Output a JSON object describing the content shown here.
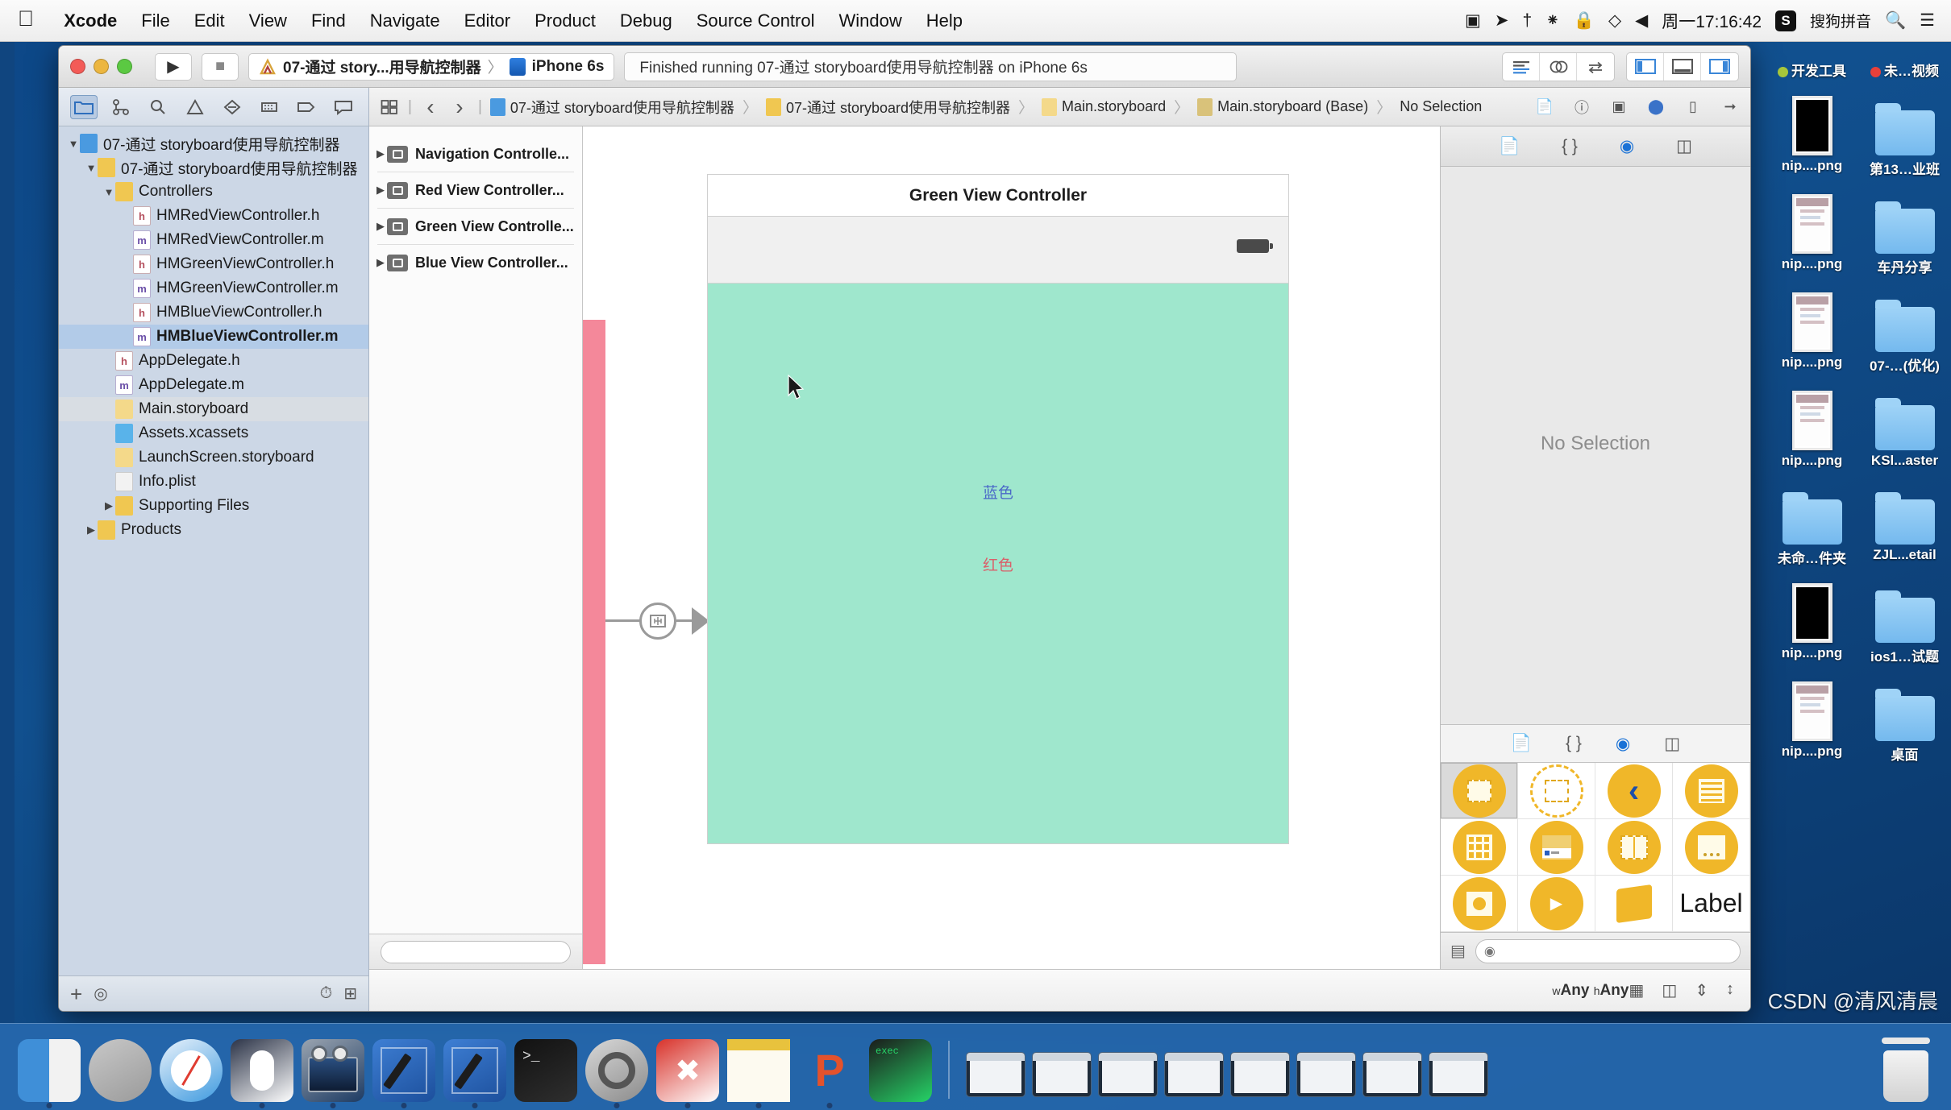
{
  "menubar": {
    "apple_icon": "apple-logo",
    "items": [
      {
        "label": "Xcode",
        "bold": true
      },
      {
        "label": "File",
        "bold": false
      },
      {
        "label": "Edit",
        "bold": false
      },
      {
        "label": "View",
        "bold": false
      },
      {
        "label": "Find",
        "bold": false
      },
      {
        "label": "Navigate",
        "bold": false
      },
      {
        "label": "Editor",
        "bold": false
      },
      {
        "label": "Product",
        "bold": false
      },
      {
        "label": "Debug",
        "bold": false
      },
      {
        "label": "Source Control",
        "bold": false
      },
      {
        "label": "Window",
        "bold": false
      },
      {
        "label": "Help",
        "bold": false
      }
    ],
    "status_icons": [
      "screen-record-icon",
      "location-icon",
      "bluetooth-icon",
      "airdrop-icon",
      "lock-icon",
      "shield-icon",
      "volume-icon"
    ],
    "clock": "周一17:16:42",
    "ime_badge": "S",
    "ime_label": "搜狗拼音",
    "search_icon": "search-icon",
    "control_center_icon": "list-icon"
  },
  "xcode": {
    "toolbar": {
      "run_label": "run-button",
      "stop_label": "stop-button",
      "scheme_name": "07-通过 story...用导航控制器",
      "scheme_separator": "〉",
      "destination": "iPhone 6s",
      "activity": "Finished running 07-通过 storyboard使用导航控制器 on iPhone 6s",
      "right_groups": [
        [
          "standard-editor-icon",
          "assistant-editor-icon",
          "version-editor-icon"
        ],
        [
          "toggle-navigator-icon",
          "toggle-debug-area-icon",
          "toggle-utilities-icon"
        ]
      ]
    },
    "navigator": {
      "tabs": [
        "folder-icon",
        "source-control-icon",
        "search-icon",
        "warning-icon",
        "test-icon",
        "debug-icon",
        "breakpoint-icon",
        "report-icon"
      ],
      "selected_tab_index": 0,
      "tree": [
        {
          "label": "07-通过 storyboard使用导航控制器",
          "depth": 0,
          "icon": "project",
          "twisty": "▼",
          "state": "normal"
        },
        {
          "label": "07-通过 storyboard使用导航控制器",
          "depth": 1,
          "icon": "folder",
          "twisty": "▼",
          "state": "normal"
        },
        {
          "label": "Controllers",
          "depth": 2,
          "icon": "folder",
          "twisty": "▼",
          "state": "normal"
        },
        {
          "label": "HMRedViewController.h",
          "depth": 3,
          "icon": "h",
          "twisty": "",
          "state": "normal"
        },
        {
          "label": "HMRedViewController.m",
          "depth": 3,
          "icon": "m",
          "twisty": "",
          "state": "normal"
        },
        {
          "label": "HMGreenViewController.h",
          "depth": 3,
          "icon": "h",
          "twisty": "",
          "state": "normal"
        },
        {
          "label": "HMGreenViewController.m",
          "depth": 3,
          "icon": "m",
          "twisty": "",
          "state": "normal"
        },
        {
          "label": "HMBlueViewController.h",
          "depth": 3,
          "icon": "h",
          "twisty": "",
          "state": "normal"
        },
        {
          "label": "HMBlueViewController.m",
          "depth": 3,
          "icon": "m",
          "twisty": "",
          "state": "selected"
        },
        {
          "label": "AppDelegate.h",
          "depth": 2,
          "icon": "h",
          "twisty": "",
          "state": "normal"
        },
        {
          "label": "AppDelegate.m",
          "depth": 2,
          "icon": "m",
          "twisty": "",
          "state": "normal"
        },
        {
          "label": "Main.storyboard",
          "depth": 2,
          "icon": "sb",
          "twisty": "",
          "state": "highlight"
        },
        {
          "label": "Assets.xcassets",
          "depth": 2,
          "icon": "xc",
          "twisty": "",
          "state": "normal"
        },
        {
          "label": "LaunchScreen.storyboard",
          "depth": 2,
          "icon": "sb",
          "twisty": "",
          "state": "normal"
        },
        {
          "label": "Info.plist",
          "depth": 2,
          "icon": "pl",
          "twisty": "",
          "state": "normal"
        },
        {
          "label": "Supporting Files",
          "depth": 2,
          "icon": "folder",
          "twisty": "▶",
          "state": "normal"
        },
        {
          "label": "Products",
          "depth": 1,
          "icon": "folder",
          "twisty": "▶",
          "state": "normal"
        }
      ],
      "footer": {
        "add_icon": "+",
        "filter_icon": "filter-icon",
        "recent_icon": "clock-icon",
        "unsaved_icon": "unsaved-icon"
      }
    },
    "jumpbar": {
      "related_icon": "related-items-icon",
      "back_icon": "‹",
      "forward_icon": "›",
      "breadcrumbs": [
        "07-通过 storyboard使用导航控制器",
        "07-通过 storyboard使用导航控制器",
        "Main.storyboard",
        "Main.storyboard (Base)",
        "No Selection"
      ],
      "right_icons": [
        "page-icon",
        "help-icon",
        "minimap-icon",
        "shield-icon",
        "device-icon",
        "arrow-icon"
      ]
    },
    "outline": {
      "items": [
        {
          "label": "Navigation Controlle...",
          "twisty": "▶"
        },
        {
          "label": "Red View Controller...",
          "twisty": "▶"
        },
        {
          "label": "Green View Controlle...",
          "twisty": "▶"
        },
        {
          "label": "Blue View Controller...",
          "twisty": "▶"
        }
      ],
      "footer_icon": "filter-oval"
    },
    "canvas": {
      "scene_title": "Green View Controller",
      "labels": [
        {
          "text": "蓝色",
          "color": "#4a68c8"
        },
        {
          "text": "红色",
          "color": "#d9606a"
        }
      ],
      "segue_icon": "segue-icon",
      "cursor_icon": "mouse-cursor",
      "bottom_bar": {
        "size_class_w": "wAny",
        "size_class_h": "hAny",
        "w_prefix": "w",
        "h_prefix": "h",
        "right_icons": [
          "grid-icon",
          "constraints-icon",
          "align-icon",
          "resolve-icon"
        ]
      }
    },
    "inspector": {
      "tabs": [
        "file-inspector-icon",
        "quick-help-icon",
        "identity-inspector-icon",
        "attributes-inspector-icon"
      ],
      "selected_tab_index": 2,
      "empty_label": "No Selection",
      "library_tabs": [
        "file-template-library-icon",
        "code-snippet-library-icon",
        "object-library-icon",
        "media-library-icon"
      ],
      "library_selected_index": 2,
      "library_items": [
        {
          "name": "view-controller-object",
          "glyph": "sq",
          "selected": true
        },
        {
          "name": "storyboard-reference-object",
          "glyph": "ghost",
          "selected": false
        },
        {
          "name": "navigation-controller-object",
          "glyph": "chev",
          "selected": false
        },
        {
          "name": "table-view-controller-object",
          "glyph": "list",
          "selected": false
        },
        {
          "name": "collection-view-controller-object",
          "glyph": "grid",
          "selected": false
        },
        {
          "name": "tab-bar-controller-object",
          "glyph": "tabbar",
          "selected": false
        },
        {
          "name": "split-view-controller-object",
          "glyph": "split",
          "selected": false
        },
        {
          "name": "page-view-controller-object",
          "glyph": "page",
          "selected": false
        }
      ],
      "library_row3": [
        {
          "name": "glkit-view-controller-object",
          "glyph": "circle"
        },
        {
          "name": "avkit-player-view-controller-object",
          "glyph": "player"
        },
        {
          "name": "object-cube",
          "glyph": "cube"
        },
        {
          "name": "label-object",
          "glyph": "label",
          "text": "Label"
        }
      ],
      "library_search_icon": "search-oval",
      "library_grid_icon": "grid-view-icon"
    }
  },
  "desktop": {
    "tags": [
      {
        "label": "开发工具",
        "color": "#a8c83c"
      },
      {
        "label": "未…视频",
        "color": "#e8403a"
      }
    ],
    "icons": [
      {
        "label": "nip....png",
        "type": "shot-black"
      },
      {
        "label": "第13…业班",
        "type": "folder"
      },
      {
        "label": "nip....png",
        "type": "shot-ui"
      },
      {
        "label": "车丹分享",
        "type": "folder"
      },
      {
        "label": "nip....png",
        "type": "shot-ui"
      },
      {
        "label": "07-…(优化)",
        "type": "folder"
      },
      {
        "label": "nip....png",
        "type": "shot-ui"
      },
      {
        "label": "KSl...aster",
        "type": "folder"
      },
      {
        "label": "未命…件夹",
        "type": "folder"
      },
      {
        "label": "ZJL...etail",
        "type": "folder"
      },
      {
        "label": "nip....png",
        "type": "shot-black"
      },
      {
        "label": "ios1…试题",
        "type": "folder"
      },
      {
        "label": "nip....png",
        "type": "shot-ui"
      },
      {
        "label": "桌面",
        "type": "folder"
      }
    ]
  },
  "dock": {
    "items": [
      {
        "name": "finder",
        "color1": "#3f8fd8",
        "color2": "#f2f2f2",
        "running": true
      },
      {
        "name": "launchpad",
        "color1": "#c8c8c8",
        "color2": "#9a9a9a",
        "running": false
      },
      {
        "name": "safari",
        "color1": "#e9f2fb",
        "color2": "#3e9adf",
        "running": false
      },
      {
        "name": "mouse-app",
        "color1": "#2b3347",
        "color2": "#ffffff",
        "running": true
      },
      {
        "name": "quicktime",
        "color1": "#9aa4b0",
        "color2": "#1d3b63",
        "running": true
      },
      {
        "name": "xcode",
        "color1": "#3e7fd4",
        "color2": "#1c4f9c",
        "running": true
      },
      {
        "name": "xcode-beta",
        "color1": "#3e7fd4",
        "color2": "#1c4f9c",
        "running": true
      },
      {
        "name": "terminal",
        "color1": "#111111",
        "color2": "#2f2f2f",
        "running": false
      },
      {
        "name": "system-preferences",
        "color1": "#d8d8d8",
        "color2": "#8b8b8b",
        "running": true
      },
      {
        "name": "xmind",
        "color1": "#d8322a",
        "color2": "#ffffff",
        "running": true
      },
      {
        "name": "notes",
        "color1": "#f7f2e4",
        "color2": "#e8c23d",
        "running": true
      },
      {
        "name": "paw",
        "color1": "#e3522c",
        "color2": "#e3522c",
        "running": true
      },
      {
        "name": "exec-app",
        "color1": "#1b1b1b",
        "color2": "#26d367",
        "running": false
      }
    ],
    "minis": 8,
    "trash_label": "trash"
  },
  "watermark": "CSDN @清风清晨"
}
